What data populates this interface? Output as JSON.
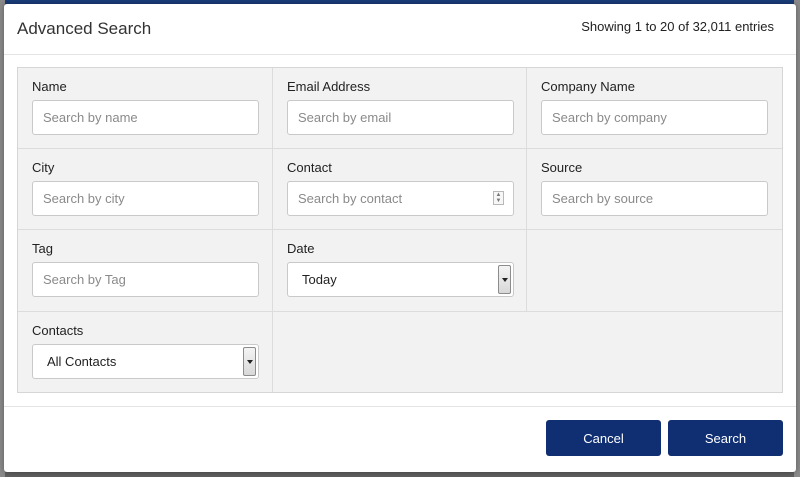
{
  "modal": {
    "title": "Advanced Search",
    "entries_info": "Showing 1 to 20 of 32,011 entries"
  },
  "fields": {
    "name": {
      "label": "Name",
      "placeholder": "Search by name"
    },
    "email": {
      "label": "Email Address",
      "placeholder": "Search by email"
    },
    "company": {
      "label": "Company Name",
      "placeholder": "Search by company"
    },
    "city": {
      "label": "City",
      "placeholder": "Search by city"
    },
    "contact": {
      "label": "Contact",
      "placeholder": "Search by contact"
    },
    "source": {
      "label": "Source",
      "placeholder": "Search by source"
    },
    "tag": {
      "label": "Tag",
      "placeholder": "Search by Tag"
    },
    "date": {
      "label": "Date",
      "selected": "Today"
    },
    "contacts": {
      "label": "Contacts",
      "selected": "All Contacts"
    }
  },
  "footer": {
    "cancel_label": "Cancel",
    "search_label": "Search"
  },
  "colors": {
    "primary_button": "#0f2f72",
    "panel_background": "#f2f2f2"
  }
}
